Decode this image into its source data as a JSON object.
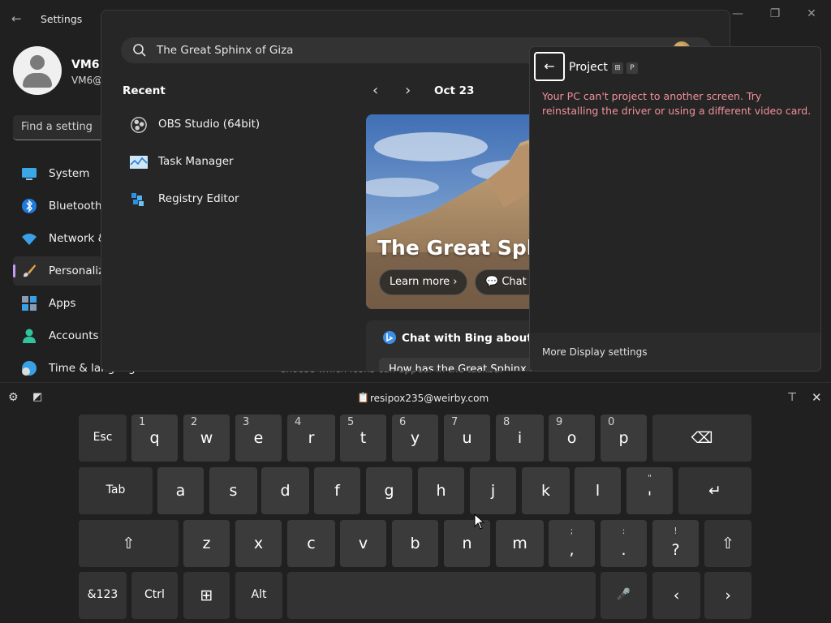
{
  "settings": {
    "title": "Settings",
    "user": {
      "name": "VM6",
      "email": "VM6@"
    },
    "search_placeholder": "Find a setting",
    "nav": [
      {
        "label": "System",
        "icon": "monitor-icon"
      },
      {
        "label": "Bluetooth",
        "icon": "bluetooth-icon"
      },
      {
        "label": "Network &",
        "icon": "wifi-icon"
      },
      {
        "label": "Personaliza",
        "icon": "brush-icon"
      },
      {
        "label": "Apps",
        "icon": "apps-icon"
      },
      {
        "label": "Accounts",
        "icon": "person-icon"
      },
      {
        "label": "Time & language",
        "icon": "clock-globe-icon"
      }
    ],
    "behind_text": "Choose which icons can appear in the taskbar"
  },
  "search": {
    "query": "The Great Sphinx of Giza",
    "recent_title": "Recent",
    "recent": [
      {
        "label": "OBS Studio (64bit)",
        "icon": "obs-icon"
      },
      {
        "label": "Task Manager",
        "icon": "task-manager-icon"
      },
      {
        "label": "Registry Editor",
        "icon": "registry-icon"
      }
    ],
    "date": "Oct 23",
    "hero": {
      "title": "The Great Sphinx of Giza",
      "learn_more": "Learn more",
      "chat": "Chat with Bing"
    },
    "bing": {
      "title": "Chat with Bing about the Great Sphinx",
      "question": "How has the Great Sphinx of Giza survived?"
    }
  },
  "project": {
    "title": "Project",
    "shortcut": [
      "⊞",
      "P"
    ],
    "message": "Your PC can't project to another screen. Try reinstalling the driver or using a different video card.",
    "footer": "More Display settings",
    "error_color": "#f2919a"
  },
  "keyboard": {
    "clipboard": "resipox235@weirby.com",
    "rows": [
      [
        {
          "k": "Esc"
        },
        {
          "k": "q",
          "a": "1"
        },
        {
          "k": "w",
          "a": "2"
        },
        {
          "k": "e",
          "a": "3"
        },
        {
          "k": "r",
          "a": "4"
        },
        {
          "k": "t",
          "a": "5"
        },
        {
          "k": "y",
          "a": "6"
        },
        {
          "k": "u",
          "a": "7"
        },
        {
          "k": "i",
          "a": "8"
        },
        {
          "k": "o",
          "a": "9"
        },
        {
          "k": "p",
          "a": "0"
        },
        {
          "k": "⌫"
        }
      ],
      [
        {
          "k": "Tab"
        },
        {
          "k": "a"
        },
        {
          "k": "s"
        },
        {
          "k": "d"
        },
        {
          "k": "f"
        },
        {
          "k": "g"
        },
        {
          "k": "h"
        },
        {
          "k": "j"
        },
        {
          "k": "k"
        },
        {
          "k": "l"
        },
        {
          "k": "'",
          "t": "\""
        },
        {
          "k": "↵"
        }
      ],
      [
        {
          "k": "⇧"
        },
        {
          "k": "z"
        },
        {
          "k": "x"
        },
        {
          "k": "c"
        },
        {
          "k": "v"
        },
        {
          "k": "b"
        },
        {
          "k": "n"
        },
        {
          "k": "m"
        },
        {
          "k": ",",
          "t": ";"
        },
        {
          "k": ".",
          "t": ":"
        },
        {
          "k": "?",
          "t": "!"
        },
        {
          "k": "⇧"
        }
      ],
      [
        {
          "k": "&123"
        },
        {
          "k": "Ctrl"
        },
        {
          "k": "⊞"
        },
        {
          "k": "Alt"
        },
        {
          "k": ""
        },
        {
          "k": "🎤"
        },
        {
          "k": "‹"
        },
        {
          "k": "›"
        }
      ]
    ]
  }
}
